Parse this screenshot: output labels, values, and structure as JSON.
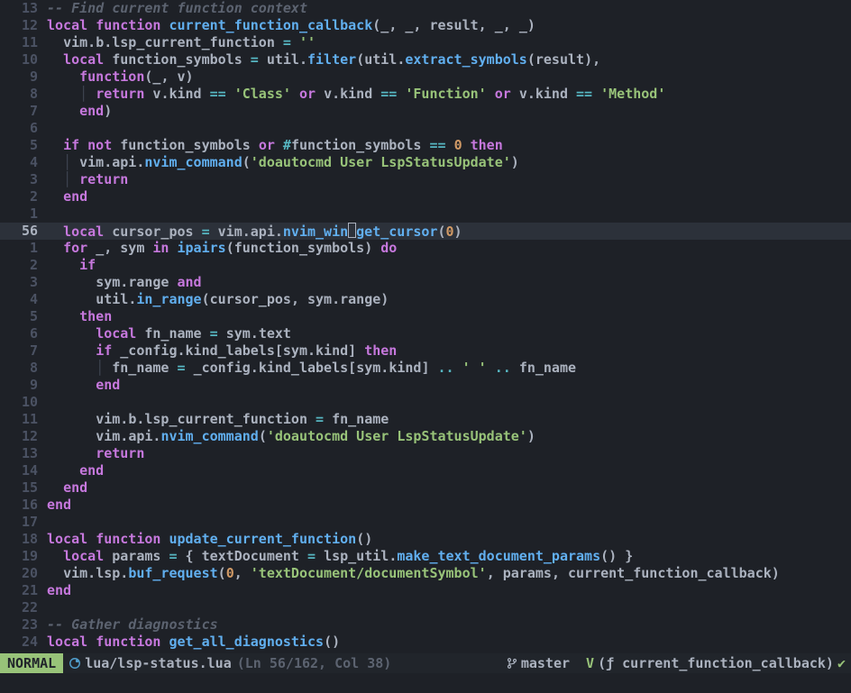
{
  "status": {
    "mode": "NORMAL",
    "file": "lua/lsp-status.lua",
    "pos": "(Ln 56/162, Col 38)",
    "git_branch": "master",
    "lsp_prefix": "V",
    "lsp_text": "(ƒ current_function_callback)",
    "lsp_check": "✔"
  },
  "current_line_number": "56",
  "lines": [
    {
      "n": "13",
      "html": "<span class='cmt'>-- Find current function context</span>"
    },
    {
      "n": "12",
      "html": "<span class='kw'>local</span> <span class='kw'>function</span> <span class='funcDef'>current_function_callback</span><span class='punc'>(</span><span class='id'>_</span><span class='punc'>, </span><span class='id'>_</span><span class='punc'>, </span><span class='id'>result</span><span class='punc'>, </span><span class='id'>_</span><span class='punc'>, </span><span class='id'>_</span><span class='punc'>)</span>"
    },
    {
      "n": "11",
      "html": "  <span class='id'>vim</span><span class='punc'>.</span><span class='id'>b</span><span class='punc'>.</span><span class='id'>lsp_current_function</span> <span class='op'>=</span> <span class='str'>''</span>"
    },
    {
      "n": "10",
      "html": "  <span class='kw'>local</span> <span class='id'>function_symbols</span> <span class='op'>=</span> <span class='id'>util</span><span class='punc'>.</span><span class='func'>filter</span><span class='punc'>(</span><span class='id'>util</span><span class='punc'>.</span><span class='func'>extract_symbols</span><span class='punc'>(</span><span class='id'>result</span><span class='punc'>),</span>"
    },
    {
      "n": "9",
      "html": "    <span class='kw'>function</span><span class='punc'>(</span><span class='id'>_</span><span class='punc'>, </span><span class='id'>v</span><span class='punc'>)</span>"
    },
    {
      "n": "8",
      "html": "    <span class='pipe'>│ </span><span class='kw'>return</span> <span class='id'>v</span><span class='punc'>.</span><span class='id'>kind</span> <span class='op'>==</span> <span class='str'>'Class'</span> <span class='kw'>or</span> <span class='id'>v</span><span class='punc'>.</span><span class='id'>kind</span> <span class='op'>==</span> <span class='str'>'Function'</span> <span class='kw'>or</span> <span class='id'>v</span><span class='punc'>.</span><span class='id'>kind</span> <span class='op'>==</span> <span class='str'>'Method'</span>"
    },
    {
      "n": "7",
      "html": "    <span class='kw'>end</span><span class='punc'>)</span>"
    },
    {
      "n": "6",
      "html": ""
    },
    {
      "n": "5",
      "html": "  <span class='kw'>if</span> <span class='kw'>not</span> <span class='id'>function_symbols</span> <span class='kw'>or</span> <span class='op'>#</span><span class='id'>function_symbols</span> <span class='op'>==</span> <span class='num'>0</span> <span class='kw'>then</span>"
    },
    {
      "n": "4",
      "html": "  <span class='pipe'>│ </span><span class='id'>vim</span><span class='punc'>.</span><span class='id'>api</span><span class='punc'>.</span><span class='func'>nvim_command</span><span class='punc'>(</span><span class='str'>'doautocmd User LspStatusUpdate'</span><span class='punc'>)</span>"
    },
    {
      "n": "3",
      "html": "  <span class='pipe'>│ </span><span class='kw'>return</span>"
    },
    {
      "n": "2",
      "html": "  <span class='kw'>end</span>"
    },
    {
      "n": "1",
      "html": ""
    },
    {
      "n": "56",
      "current": true,
      "html": "  <span class='kw'>local</span> <span class='id'>cursor_pos</span> <span class='op'>=</span> <span class='id'>vim</span><span class='punc'>.</span><span class='id'>api</span><span class='punc'>.</span><span class='func'>nvim_win</span><span class='cursorbox'></span><span class='func'>get_cursor</span><span class='punc'>(</span><span class='num'>0</span><span class='punc'>)</span>"
    },
    {
      "n": "1",
      "html": "  <span class='kw'>for</span> <span class='id'>_</span><span class='punc'>, </span><span class='id'>sym</span> <span class='kw'>in</span> <span class='func'>ipairs</span><span class='punc'>(</span><span class='id'>function_symbols</span><span class='punc'>)</span> <span class='kw'>do</span>"
    },
    {
      "n": "2",
      "html": "    <span class='kw'>if</span>"
    },
    {
      "n": "3",
      "html": "      <span class='id'>sym</span><span class='punc'>.</span><span class='id'>range</span> <span class='kw'>and</span>"
    },
    {
      "n": "4",
      "html": "      <span class='id'>util</span><span class='punc'>.</span><span class='func'>in_range</span><span class='punc'>(</span><span class='id'>cursor_pos</span><span class='punc'>, </span><span class='id'>sym</span><span class='punc'>.</span><span class='id'>range</span><span class='punc'>)</span>"
    },
    {
      "n": "5",
      "html": "    <span class='kw'>then</span>"
    },
    {
      "n": "6",
      "html": "      <span class='kw'>local</span> <span class='id'>fn_name</span> <span class='op'>=</span> <span class='id'>sym</span><span class='punc'>.</span><span class='id'>text</span>"
    },
    {
      "n": "7",
      "html": "      <span class='kw'>if</span> <span class='id'>_config</span><span class='punc'>.</span><span class='id'>kind_labels</span><span class='punc'>[</span><span class='id'>sym</span><span class='punc'>.</span><span class='id'>kind</span><span class='punc'>]</span> <span class='kw'>then</span>"
    },
    {
      "n": "8",
      "html": "      <span class='pipe'>│ </span><span class='id'>fn_name</span> <span class='op'>=</span> <span class='id'>_config</span><span class='punc'>.</span><span class='id'>kind_labels</span><span class='punc'>[</span><span class='id'>sym</span><span class='punc'>.</span><span class='id'>kind</span><span class='punc'>]</span> <span class='op'>..</span> <span class='str'>' '</span> <span class='op'>..</span> <span class='id'>fn_name</span>"
    },
    {
      "n": "9",
      "html": "      <span class='kw'>end</span>"
    },
    {
      "n": "10",
      "html": ""
    },
    {
      "n": "11",
      "html": "      <span class='id'>vim</span><span class='punc'>.</span><span class='id'>b</span><span class='punc'>.</span><span class='id'>lsp_current_function</span> <span class='op'>=</span> <span class='id'>fn_name</span>"
    },
    {
      "n": "12",
      "html": "      <span class='id'>vim</span><span class='punc'>.</span><span class='id'>api</span><span class='punc'>.</span><span class='func'>nvim_command</span><span class='punc'>(</span><span class='str'>'doautocmd User LspStatusUpdate'</span><span class='punc'>)</span>"
    },
    {
      "n": "13",
      "html": "      <span class='kw'>return</span>"
    },
    {
      "n": "14",
      "html": "    <span class='kw'>end</span>"
    },
    {
      "n": "15",
      "html": "  <span class='kw'>end</span>"
    },
    {
      "n": "16",
      "html": "<span class='kw'>end</span>"
    },
    {
      "n": "17",
      "html": ""
    },
    {
      "n": "18",
      "html": "<span class='kw'>local</span> <span class='kw'>function</span> <span class='funcDef'>update_current_function</span><span class='punc'>()</span>"
    },
    {
      "n": "19",
      "html": "  <span class='kw'>local</span> <span class='id'>params</span> <span class='op'>=</span> <span class='punc'>{</span> <span class='id'>textDocument</span> <span class='op'>=</span> <span class='id'>lsp_util</span><span class='punc'>.</span><span class='func'>make_text_document_params</span><span class='punc'>()</span> <span class='punc'>}</span>"
    },
    {
      "n": "20",
      "html": "  <span class='id'>vim</span><span class='punc'>.</span><span class='id'>lsp</span><span class='punc'>.</span><span class='func'>buf_request</span><span class='punc'>(</span><span class='num'>0</span><span class='punc'>, </span><span class='str'>'textDocument/documentSymbol'</span><span class='punc'>, </span><span class='id'>params</span><span class='punc'>, </span><span class='id'>current_function_callback</span><span class='punc'>)</span>"
    },
    {
      "n": "21",
      "html": "<span class='kw'>end</span>"
    },
    {
      "n": "22",
      "html": ""
    },
    {
      "n": "23",
      "html": "<span class='cmt'>-- Gather diagnostics</span>"
    },
    {
      "n": "24",
      "html": "<span class='kw'>local</span> <span class='kw'>function</span> <span class='funcDef'>get_all_diagnostics</span><span class='punc'>()</span>"
    }
  ]
}
